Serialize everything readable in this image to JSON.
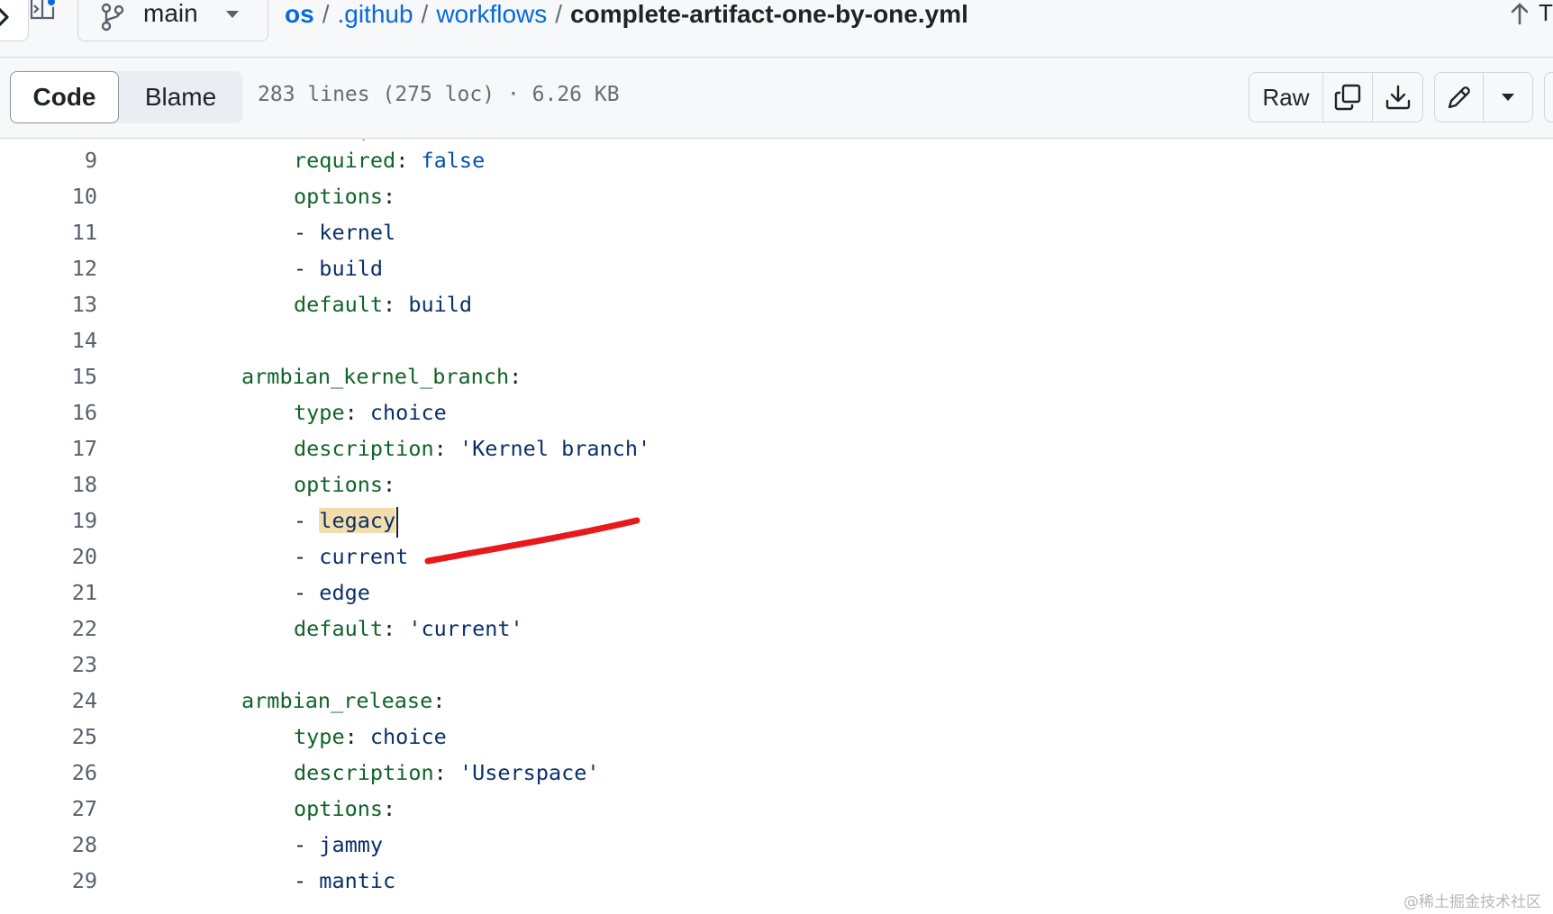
{
  "breadcrumb": {
    "branch": "main",
    "parts": [
      "os",
      ".github",
      "workflows"
    ],
    "separator": "/",
    "file": "complete-artifact-one-by-one.yml",
    "right_partial_text": "T"
  },
  "header": {
    "tabs": [
      {
        "label": "Code",
        "selected": true
      },
      {
        "label": "Blame",
        "selected": false
      }
    ],
    "file_info": "283 lines (275 loc) · 6.26 KB",
    "raw_label": "Raw",
    "icons": [
      "copy-icon",
      "download-icon",
      "pencil-icon",
      "triangle-down-icon"
    ]
  },
  "code": {
    "lines": [
      {
        "n": "9",
        "indent": 2,
        "tokens": [
          [
            "key",
            "required"
          ],
          [
            "punct",
            ": "
          ],
          [
            "bool",
            "false"
          ]
        ]
      },
      {
        "n": "10",
        "indent": 2,
        "tokens": [
          [
            "key",
            "options"
          ],
          [
            "punct",
            ":"
          ]
        ]
      },
      {
        "n": "11",
        "indent": 2,
        "tokens": [
          [
            "punct",
            "- "
          ],
          [
            "val",
            "kernel"
          ]
        ]
      },
      {
        "n": "12",
        "indent": 2,
        "tokens": [
          [
            "punct",
            "- "
          ],
          [
            "val",
            "build"
          ]
        ]
      },
      {
        "n": "13",
        "indent": 2,
        "tokens": [
          [
            "key",
            "default"
          ],
          [
            "punct",
            ": "
          ],
          [
            "val",
            "build"
          ]
        ]
      },
      {
        "n": "14",
        "indent": 0,
        "tokens": []
      },
      {
        "n": "15",
        "indent": 0,
        "tokens": [
          [
            "key",
            "armbian_kernel_branch"
          ],
          [
            "punct",
            ":"
          ]
        ]
      },
      {
        "n": "16",
        "indent": 2,
        "tokens": [
          [
            "key",
            "type"
          ],
          [
            "punct",
            ": "
          ],
          [
            "val",
            "choice"
          ]
        ]
      },
      {
        "n": "17",
        "indent": 2,
        "tokens": [
          [
            "key",
            "description"
          ],
          [
            "punct",
            ": "
          ],
          [
            "val",
            "'Kernel branch'"
          ]
        ]
      },
      {
        "n": "18",
        "indent": 2,
        "tokens": [
          [
            "key",
            "options"
          ],
          [
            "punct",
            ":"
          ]
        ]
      },
      {
        "n": "19",
        "indent": 2,
        "tokens": [
          [
            "punct",
            "- "
          ],
          [
            "hl",
            "legacy"
          ]
        ]
      },
      {
        "n": "20",
        "indent": 2,
        "tokens": [
          [
            "punct",
            "- "
          ],
          [
            "val",
            "current"
          ]
        ]
      },
      {
        "n": "21",
        "indent": 2,
        "tokens": [
          [
            "punct",
            "- "
          ],
          [
            "val",
            "edge"
          ]
        ]
      },
      {
        "n": "22",
        "indent": 2,
        "tokens": [
          [
            "key",
            "default"
          ],
          [
            "punct",
            ": "
          ],
          [
            "val",
            "'current'"
          ]
        ]
      },
      {
        "n": "23",
        "indent": 0,
        "tokens": []
      },
      {
        "n": "24",
        "indent": 0,
        "tokens": [
          [
            "key",
            "armbian_release"
          ],
          [
            "punct",
            ":"
          ]
        ]
      },
      {
        "n": "25",
        "indent": 2,
        "tokens": [
          [
            "key",
            "type"
          ],
          [
            "punct",
            ": "
          ],
          [
            "val",
            "choice"
          ]
        ]
      },
      {
        "n": "26",
        "indent": 2,
        "tokens": [
          [
            "key",
            "description"
          ],
          [
            "punct",
            ": "
          ],
          [
            "val",
            "'Userspace'"
          ]
        ]
      },
      {
        "n": "27",
        "indent": 2,
        "tokens": [
          [
            "key",
            "options"
          ],
          [
            "punct",
            ":"
          ]
        ]
      },
      {
        "n": "28",
        "indent": 2,
        "tokens": [
          [
            "punct",
            "- "
          ],
          [
            "val",
            "jammy"
          ]
        ]
      },
      {
        "n": "29",
        "indent": 2,
        "tokens": [
          [
            "punct",
            "- "
          ],
          [
            "val",
            "mantic"
          ]
        ]
      }
    ],
    "highlighted_word": "legacy"
  },
  "annotation": {
    "color": "#e8191a"
  },
  "colors": {
    "link": "#0969da",
    "yaml_key": "#116329",
    "yaml_value": "#0a3069",
    "yaml_bool": "#0550ae",
    "highlight": "#f3deab"
  },
  "watermark": "@稀土掘金技术社区"
}
